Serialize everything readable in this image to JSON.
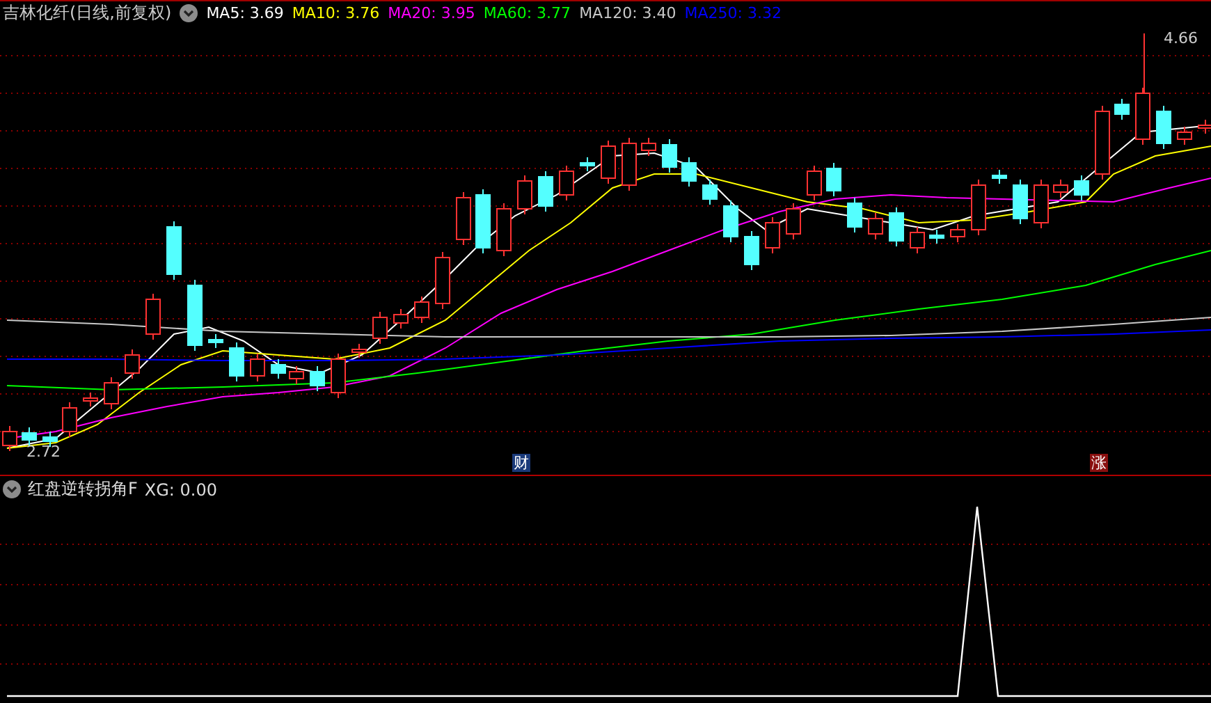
{
  "chart_header": {
    "title": "吉林化纤(日线,前复权)",
    "moving_averages": [
      {
        "label": "MA5: 3.69",
        "color": "#ffffff"
      },
      {
        "label": "MA10: 3.76",
        "color": "#ffff00"
      },
      {
        "label": "MA20: 3.95",
        "color": "#ff00ff"
      },
      {
        "label": "MA60: 3.77",
        "color": "#00ff00"
      },
      {
        "label": "MA120: 3.40",
        "color": "#c8c8c8"
      },
      {
        "label": "MA250: 3.32",
        "color": "#0000ff"
      }
    ]
  },
  "price_chart": {
    "high_label": "4.66",
    "low_label": "2.72",
    "markers": [
      {
        "text": "财",
        "color": "#1a3a7a"
      },
      {
        "text": "涨",
        "color": "#8a1010"
      }
    ]
  },
  "indicator": {
    "title": "红盘逆转拐角F",
    "reading": "XG: 0.00"
  }
}
